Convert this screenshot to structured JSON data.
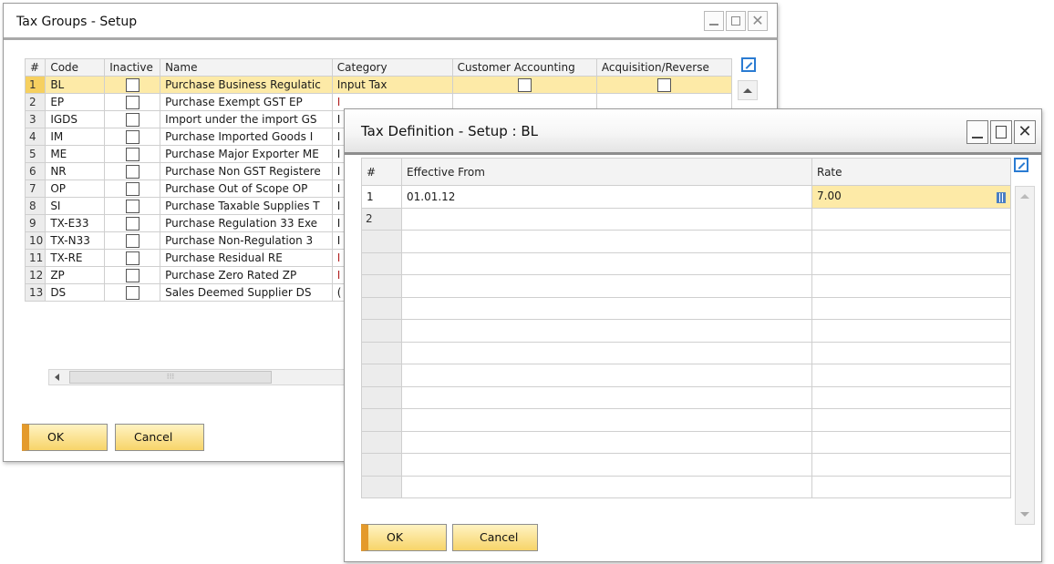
{
  "tax_groups": {
    "title": "Tax Groups - Setup",
    "columns": [
      "#",
      "Code",
      "Inactive",
      "Name",
      "Category",
      "Customer Accounting",
      "Acquisition/Reverse"
    ],
    "rows": [
      {
        "num": "1",
        "code": "BL",
        "name": "Purchase Business Regulatic",
        "category": "Input Tax"
      },
      {
        "num": "2",
        "code": "EP",
        "name": "Purchase Exempt GST EP",
        "category": "I"
      },
      {
        "num": "3",
        "code": "IGDS",
        "name": "Import under the import GS",
        "category": "I"
      },
      {
        "num": "4",
        "code": "IM",
        "name": "Purchase Imported Goods I",
        "category": "I"
      },
      {
        "num": "5",
        "code": "ME",
        "name": "Purchase Major Exporter ME",
        "category": "I"
      },
      {
        "num": "6",
        "code": "NR",
        "name": "Purchase Non GST Registere",
        "category": "I"
      },
      {
        "num": "7",
        "code": "OP",
        "name": "Purchase Out of Scope OP",
        "category": "I"
      },
      {
        "num": "8",
        "code": "SI",
        "name": "Purchase Taxable Supplies T",
        "category": "I"
      },
      {
        "num": "9",
        "code": "TX-E33",
        "name": "Purchase Regulation 33 Exe",
        "category": "I"
      },
      {
        "num": "10",
        "code": "TX-N33",
        "name": "Purchase Non-Regulation 3",
        "category": "I"
      },
      {
        "num": "11",
        "code": "TX-RE",
        "name": "Purchase Residual RE",
        "category": "I"
      },
      {
        "num": "12",
        "code": "ZP",
        "name": "Purchase Zero Rated ZP",
        "category": "I"
      },
      {
        "num": "13",
        "code": "DS",
        "name": "Sales Deemed Supplier DS",
        "category": "("
      }
    ],
    "ok_label": "OK",
    "cancel_label": "Cancel"
  },
  "tax_definition": {
    "title": "Tax Definition - Setup : BL",
    "columns": [
      "#",
      "Effective From",
      "Rate"
    ],
    "rows": [
      {
        "num": "1",
        "effective_from": "01.01.12",
        "rate": "7.00"
      },
      {
        "num": "2",
        "effective_from": "",
        "rate": ""
      }
    ],
    "ok_label": "OK",
    "cancel_label": "Cancel"
  },
  "icons": {
    "minimize": "minimize-icon",
    "maximize": "maximize-icon",
    "close": "close-icon",
    "expand": "expand-arrow-icon",
    "calculator": "calculator-icon"
  },
  "colors": {
    "selected_row": "#fdeaa7",
    "selected_rownum": "#f6d060",
    "button_accent": "#e49a2b",
    "expand_icon": "#2a7bd2"
  }
}
